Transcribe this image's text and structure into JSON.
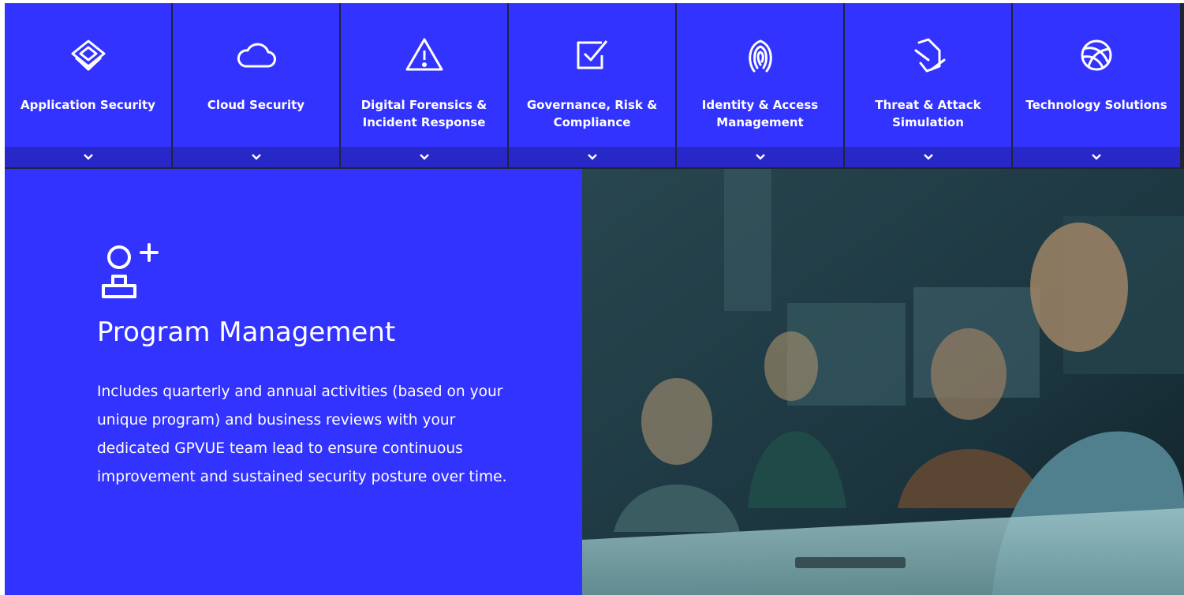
{
  "nav": {
    "tabs": [
      {
        "label": "Application Security",
        "icon": "layers-icon"
      },
      {
        "label": "Cloud Security",
        "icon": "cloud-icon"
      },
      {
        "label": "Digital Forensics & Incident Response",
        "icon": "warning-icon"
      },
      {
        "label": "Governance, Risk & Compliance",
        "icon": "checkbox-icon"
      },
      {
        "label": "Identity & Access Management",
        "icon": "fingerprint-icon"
      },
      {
        "label": "Threat & Attack Simulation",
        "icon": "threat-icon"
      },
      {
        "label": "Technology Solutions",
        "icon": "globe-icon"
      }
    ]
  },
  "panel": {
    "icon": "add-user-icon",
    "title": "Program Management",
    "body": "Includes quarterly and annual activities (based on your unique program) and business reviews with your dedicated GPVUE team lead to ensure continuous improvement and sustained security posture over time."
  },
  "colors": {
    "accent": "#3333ff",
    "accent_dark": "#2828c8",
    "divider": "#1f2437",
    "text": "#ffffff"
  }
}
